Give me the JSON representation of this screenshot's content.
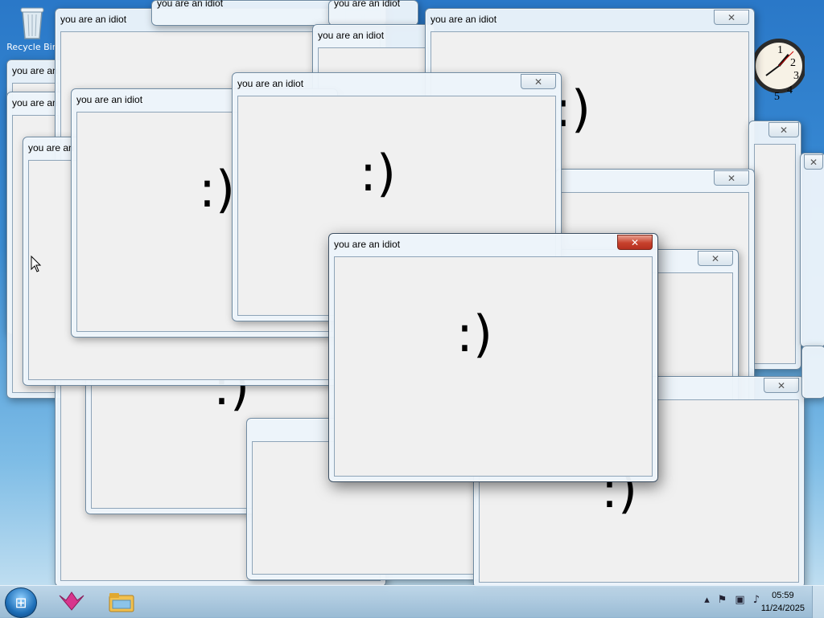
{
  "desktop": {
    "recycle_bin_label": "Recycle Bin"
  },
  "popup": {
    "title": "you are an idiot",
    "smiley": ":)",
    "close_glyph": "✕"
  },
  "taskbar": {
    "start_glyph": "⊞",
    "tray_arrow": "▴",
    "tray_flag": "⚑",
    "tray_network": "▣",
    "tray_volume": "♪"
  },
  "clock": {
    "time": "05:59",
    "date": "11/24/2025"
  },
  "gadget_clock": {
    "numerals": [
      "1",
      "2",
      "3",
      "4",
      "5"
    ]
  }
}
